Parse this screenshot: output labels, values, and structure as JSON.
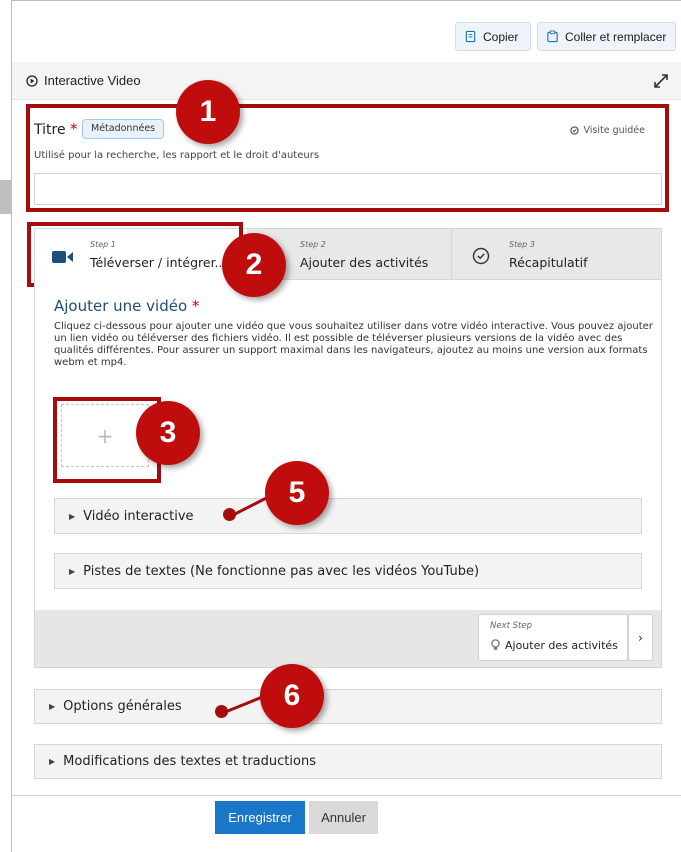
{
  "toolbar": {
    "copy_label": "Copier",
    "paste_label": "Coller et remplacer"
  },
  "panel": {
    "title": "Interactive Video"
  },
  "title_field": {
    "label": "Titre",
    "required_mark": "*",
    "metadata_label": "Métadonnées",
    "tour_label": "Visite guidée",
    "description": "Utilisé pour la recherche, les rapport et le droit d'auteurs",
    "value": ""
  },
  "steps": [
    {
      "number": "Step 1",
      "label": "Téléverser / intégrer..."
    },
    {
      "number": "Step 2",
      "label": "Ajouter des activités"
    },
    {
      "number": "Step 3",
      "label": "Récapitulatif"
    }
  ],
  "video": {
    "title": "Ajouter une vidéo",
    "required_mark": "*",
    "description": "Cliquez ci-dessous pour ajouter une vidéo que vous souhaitez utiliser dans votre vidéo interactive. Vous pouvez ajouter un lien vidéo ou téléverser des fichiers vidéo. Il est possible de téléverser plusieurs versions de la vidéo avec des qualités différentes. Pour assurer un support maximal dans les navigateurs, ajoutez au moins une version aux formats webm et mp4.",
    "add_symbol": "+"
  },
  "accordions": {
    "interactive_video": "Vidéo interactive",
    "text_tracks": "Pistes de textes (Ne fonctionne pas avec les vidéos YouTube)",
    "general_options": "Options générales",
    "text_overrides": "Modifications des textes et traductions"
  },
  "next_step": {
    "caption": "Next Step",
    "label": "Ajouter des activités",
    "arrow": "›"
  },
  "callouts": {
    "n1": "1",
    "n2": "2",
    "n3": "3",
    "n5": "5",
    "n6": "6"
  },
  "footer": {
    "save_label": "Enregistrer",
    "cancel_label": "Annuler"
  },
  "colors": {
    "accent_red": "#a50d0d",
    "primary_blue": "#1976c9",
    "heading_blue": "#1f4e79"
  },
  "icons": [
    "copy-icon",
    "paste-icon",
    "play-circle-icon",
    "expand-icon",
    "video-camera-icon",
    "check-circle-icon",
    "bulb-icon"
  ]
}
